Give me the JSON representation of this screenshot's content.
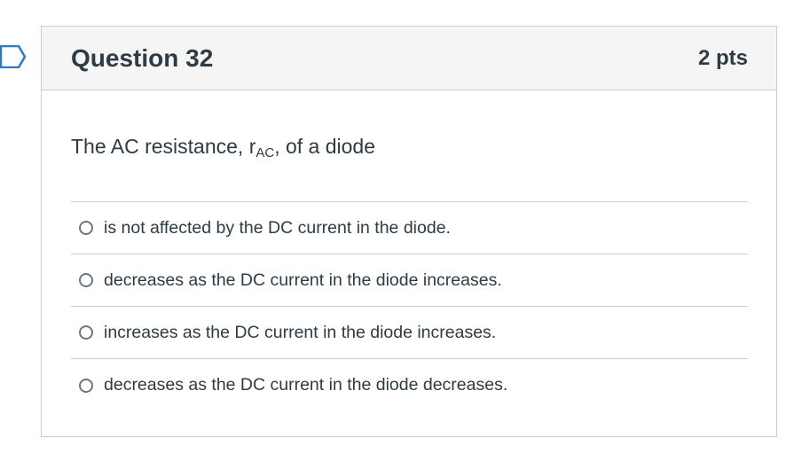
{
  "question": {
    "title": "Question 32",
    "points": "2 pts",
    "text_before": "The AC resistance, r",
    "text_sub": "AC",
    "text_after": ", of a diode",
    "answers": [
      {
        "label": "is not affected by the DC current in the diode."
      },
      {
        "label": "decreases as the DC current in the diode increases."
      },
      {
        "label": "increases as the DC current in the diode increases."
      },
      {
        "label": "decreases as the DC current in the diode decreases."
      }
    ]
  },
  "icons": {
    "flag": "flag-icon",
    "radio": "radio-unchecked-icon"
  },
  "colors": {
    "text": "#2d3b45",
    "border": "#c7cdd1",
    "header_bg": "#f5f5f5",
    "flag": "#2b7abc"
  }
}
